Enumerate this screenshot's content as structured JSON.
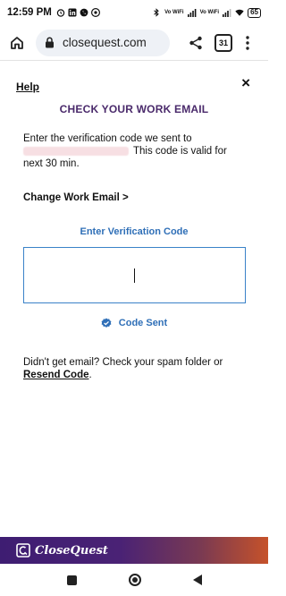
{
  "status_bar": {
    "time": "12:59 PM",
    "notification_icons": [
      "alarm-icon",
      "linkedin-icon",
      "whatsapp-icon",
      "chrome-icon"
    ],
    "network_label_1": "Vo WiFi",
    "network_label_2": "Vo WiFi",
    "battery": "65"
  },
  "browser": {
    "url": "closequest.com",
    "tab_count": "31"
  },
  "page": {
    "help_label": "Help",
    "close_label": "×",
    "title": "CHECK YOUR WORK EMAIL",
    "instructions_part1": "Enter the verification code we sent to",
    "instructions_part2": "This code is valid for next 30 min.",
    "change_email_label": "Change Work Email >",
    "code_label": "Enter Verification Code",
    "code_value": "",
    "code_sent_label": "Code Sent",
    "spam_note": "Didn't get email? Check your spam folder or",
    "resend_label": "Resend Code",
    "resend_suffix": "."
  },
  "brand": {
    "name": "CloseQuest"
  },
  "colors": {
    "title": "#4a2a6b",
    "link_blue": "#2f6fb7",
    "brand_gradient_start": "#3e1d72",
    "brand_gradient_end": "#c6522a"
  }
}
